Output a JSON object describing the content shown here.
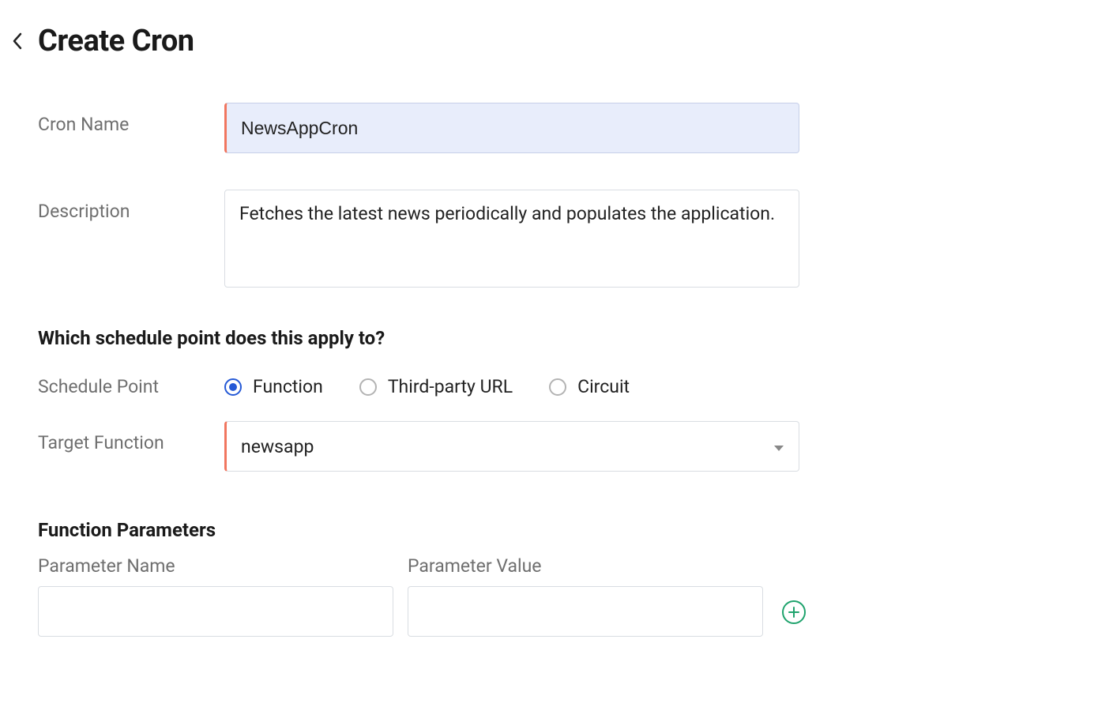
{
  "header": {
    "title": "Create Cron"
  },
  "form": {
    "cron_name_label": "Cron Name",
    "cron_name_value": "NewsAppCron",
    "description_label": "Description",
    "description_value": "Fetches the latest news periodically and populates the application.",
    "schedule_question": "Which schedule point does this apply to?",
    "schedule_point_label": "Schedule Point",
    "radios": {
      "function": "Function",
      "third_party": "Third-party URL",
      "circuit": "Circuit"
    },
    "target_function_label": "Target Function",
    "target_function_value": "newsapp",
    "params_heading": "Function Parameters",
    "param_name_label": "Parameter Name",
    "param_value_label": "Parameter Value",
    "param_name_value": "",
    "param_value_value": ""
  }
}
